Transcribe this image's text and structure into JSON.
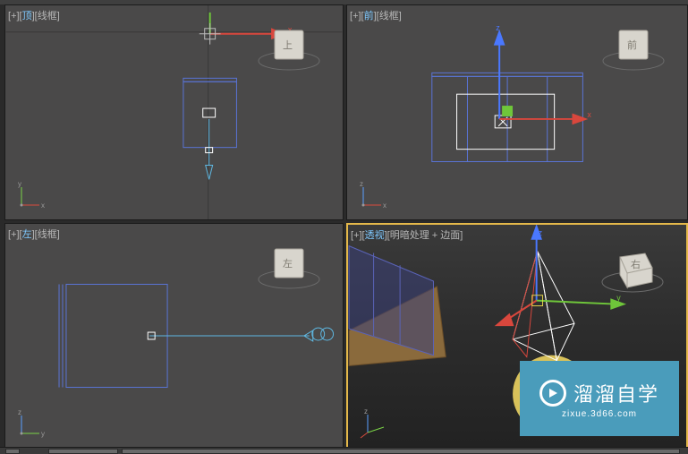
{
  "viewports": {
    "top": {
      "plus": "+",
      "name": "顶",
      "shade": "线框"
    },
    "front": {
      "plus": "+",
      "name": "前",
      "shade": "线框"
    },
    "left": {
      "plus": "+",
      "name": "左",
      "shade": "线框"
    },
    "persp": {
      "plus": "+",
      "name": "透视",
      "shade": "明暗处理 + 边面"
    }
  },
  "axis_labels": {
    "x": "x",
    "y": "y",
    "z": "z"
  },
  "viewcube": {
    "top_face": "上",
    "front_face": "前",
    "left_face": "左",
    "right_face": "右"
  },
  "watermark": {
    "title": "溜溜自学",
    "subtitle": "zixue.3d66.com"
  },
  "colors": {
    "viewport_bg": "#4a4949",
    "active_border": "#e4b84a",
    "axis_x": "#d94b3d",
    "axis_y": "#7bd447",
    "axis_z": "#5aa0ff",
    "wire_blue": "#5a74d6",
    "wire_cyan": "#5fb8e2",
    "watermark_bg": "#4a9cbb"
  },
  "chart_data": null
}
